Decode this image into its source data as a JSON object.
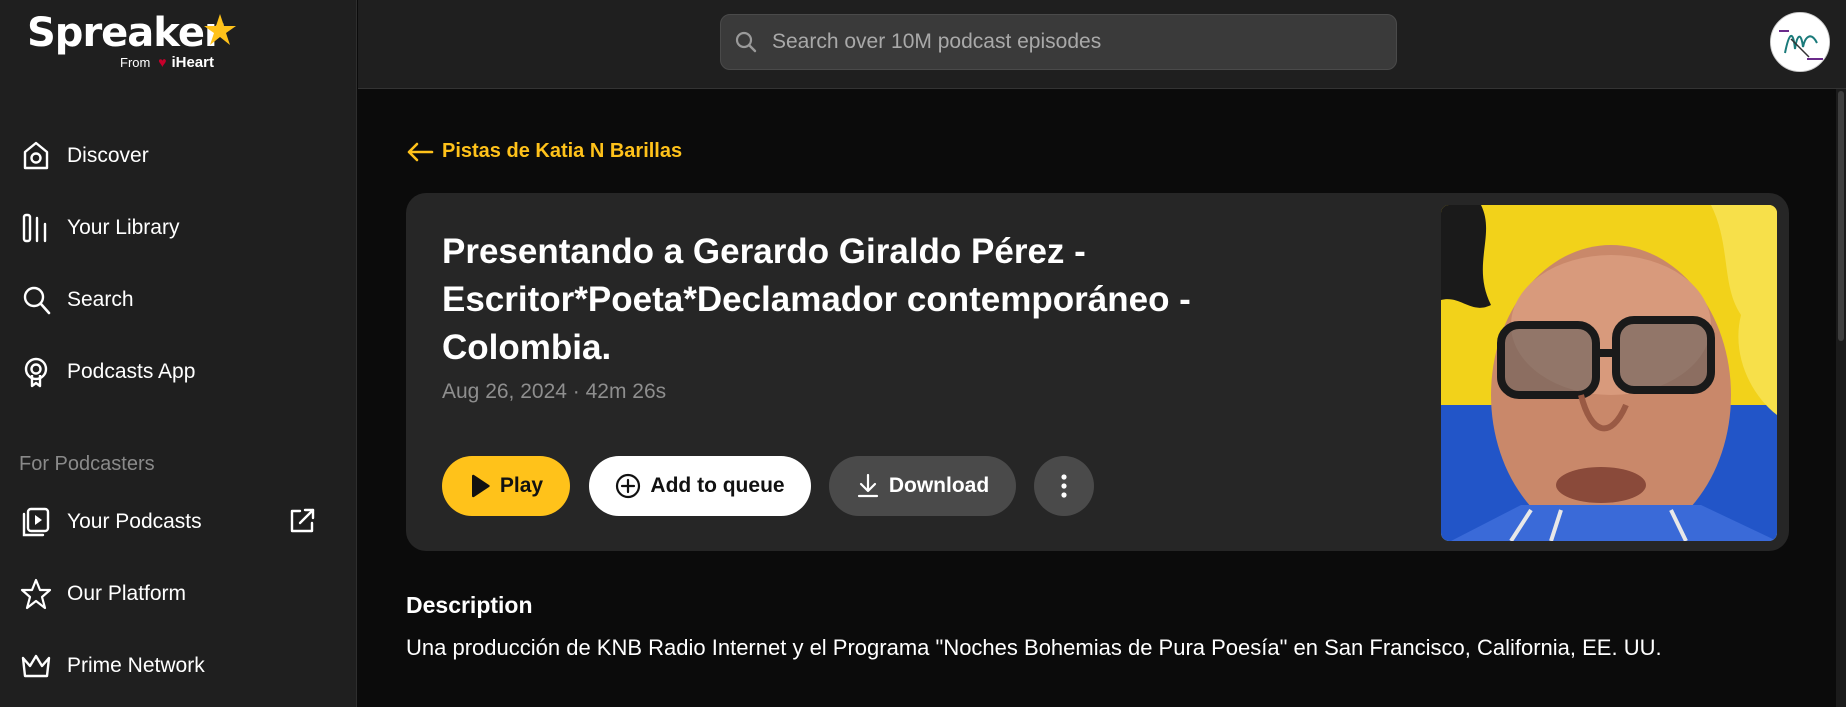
{
  "brand": {
    "logo_text": "Spreaker",
    "logo_from": "From",
    "logo_partner": "iHeart"
  },
  "sidebar": {
    "items": [
      {
        "label": "Discover",
        "icon": "discover-icon"
      },
      {
        "label": "Your Library",
        "icon": "library-icon"
      },
      {
        "label": "Search",
        "icon": "search-icon"
      },
      {
        "label": "Podcasts App",
        "icon": "podcasts-app-icon"
      }
    ],
    "section_label": "For Podcasters",
    "podcaster_items": [
      {
        "label": "Your Podcasts",
        "icon": "your-podcasts-icon"
      },
      {
        "label": "Our Platform",
        "icon": "platform-star-icon"
      },
      {
        "label": "Prime Network",
        "icon": "crown-icon"
      }
    ]
  },
  "topbar": {
    "search_placeholder": "Search over 10M podcast episodes"
  },
  "back_link": {
    "label": "Pistas de Katia N Barillas"
  },
  "episode": {
    "title": "Presentando a Gerardo Giraldo Pérez - Escritor*Poeta*Declamador contemporáneo - Colombia.",
    "meta": "Aug 26, 2024 · 42m 26s"
  },
  "actions": {
    "play": "Play",
    "queue": "Add to queue",
    "download": "Download"
  },
  "description": {
    "heading": "Description",
    "body": "Una producción de KNB Radio Internet y el Programa \"Noches Bohemias de Pura Poesía\" en San Francisco, California, EE. UU."
  },
  "colors": {
    "accent": "#ffc21a",
    "background": "#0b0b0b",
    "sidebar": "#1f1f1f",
    "card": "#262626"
  }
}
